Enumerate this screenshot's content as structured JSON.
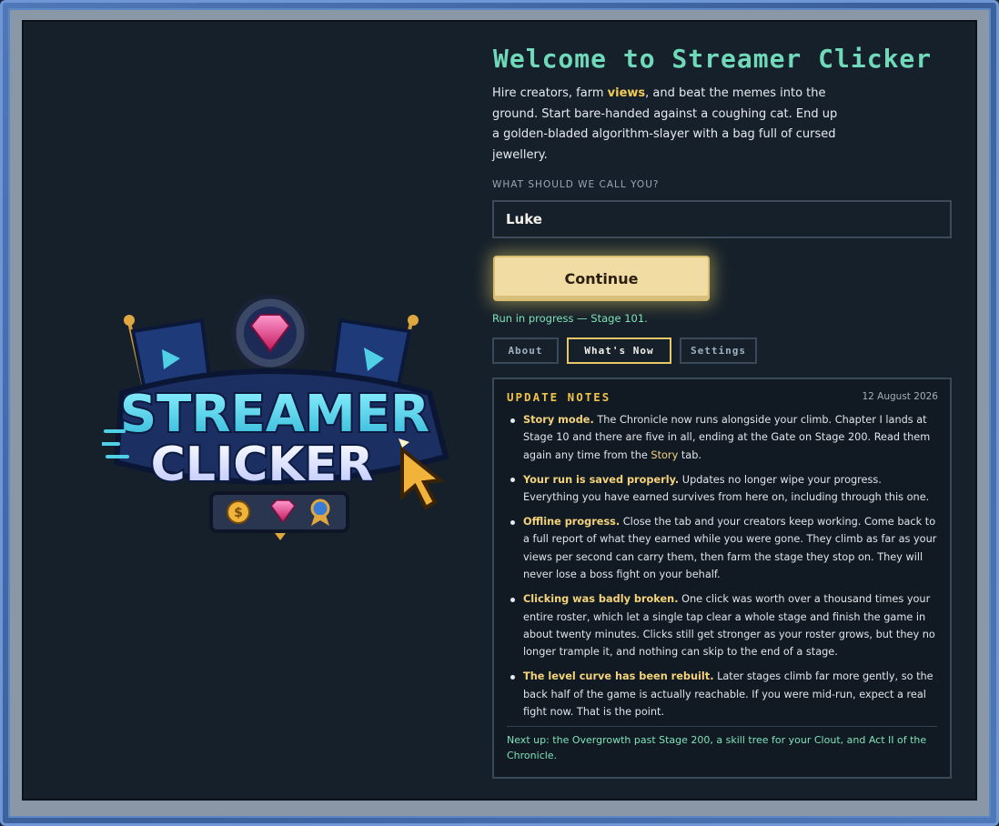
{
  "app": {
    "title": "Welcome to Streamer Clicker",
    "logo_text": "STREAMER CLICKER"
  },
  "intro": {
    "part1": "Hire creators, farm ",
    "highlight": "views",
    "part2": ", and beat the memes into the ground. Start bare-handed against a coughing cat. End up a golden-bladed algorithm-slayer with a bag full of cursed jewellery."
  },
  "name_field": {
    "label": "WHAT SHOULD WE CALL YOU?",
    "value": "Luke"
  },
  "continue_button": {
    "label": "Continue"
  },
  "progress_note": "Run in progress — Stage 101.",
  "tabs": [
    {
      "label": "About",
      "active": false
    },
    {
      "label": "What's Now",
      "active": true
    },
    {
      "label": "Settings",
      "active": false
    }
  ],
  "update_notes": {
    "title": "UPDATE NOTES",
    "date": "12 August 2026",
    "items": [
      {
        "heading": "Story mode.",
        "text": "The Chronicle now runs alongside your climb. Chapter I lands at Stage 10 and there are five in all, ending at the Gate on Stage 200. Read them again any time from the",
        "link": "Story",
        "tail": "tab."
      },
      {
        "heading": "Your run is saved properly.",
        "text": "Updates no longer wipe your progress. Everything you have earned survives from here on, including through this one."
      },
      {
        "heading": "Offline progress.",
        "text": "Close the tab and your creators keep working. Come back to a full report of what they earned while you were gone. They climb as far as your views per second can carry them, then farm the stage they stop on. They will never lose a boss fight on your behalf."
      },
      {
        "heading": "Clicking was badly broken.",
        "text": "One click was worth over a thousand times your entire roster, which let a single tap clear a whole stage and finish the game in about twenty minutes. Clicks still get stronger as your roster grows, but they no longer trample it, and nothing can skip to the end of a stage."
      },
      {
        "heading": "The level curve has been rebuilt.",
        "text": "Later stages climb far more gently, so the back half of the game is actually reachable. If you were mid-run, expect a real fight now. That is the point."
      }
    ],
    "next_up": "Next up: the Overgrowth past Stage 200, a skill tree for your Clout, and Act II of the Chronicle."
  },
  "colors": {
    "accent_teal": "#6fd9b9",
    "accent_gold": "#f0c24a",
    "button_bg": "#f1dca3",
    "panel_bg": "#16202a"
  }
}
